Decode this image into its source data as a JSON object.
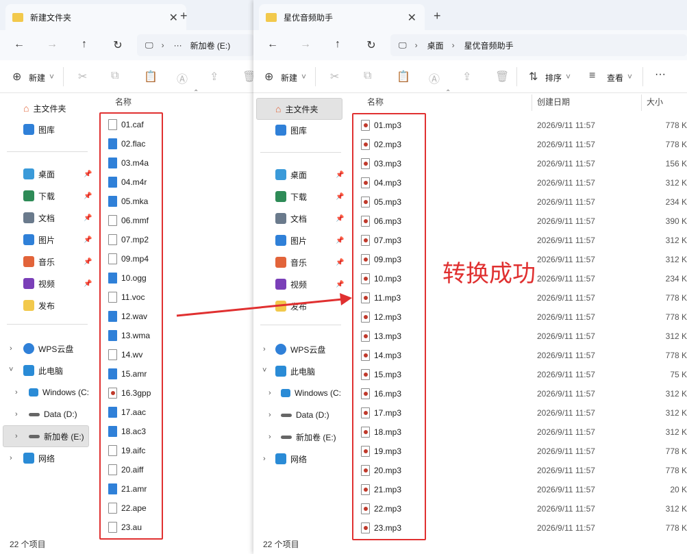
{
  "left": {
    "tab_title": "新建文件夹",
    "path": [
      "新加卷 (E:)"
    ],
    "path_more": "···",
    "toolbar_new": "新建",
    "col_name": "名称",
    "nav": {
      "home": "主文件夹",
      "gallery": "图库",
      "quick": [
        {
          "label": "桌面",
          "icon": "desktop-icon",
          "color": "#3a9ad9"
        },
        {
          "label": "下载",
          "icon": "download-icon",
          "color": "#2e8b57"
        },
        {
          "label": "文档",
          "icon": "document-icon",
          "color": "#6a7a8c"
        },
        {
          "label": "图片",
          "icon": "picture-icon",
          "color": "#2f80d8"
        },
        {
          "label": "音乐",
          "icon": "music-icon",
          "color": "#e2643a"
        },
        {
          "label": "视频",
          "icon": "video-icon",
          "color": "#7a3fb8"
        },
        {
          "label": "发布",
          "icon": "folder-icon",
          "color": "#f2c94c"
        }
      ],
      "wps": "WPS云盘",
      "thispc": "此电脑",
      "drives": [
        "Windows (C:",
        "Data (D:)",
        "新加卷 (E:)"
      ],
      "network": "网络"
    },
    "files": [
      {
        "name": "01.caf",
        "type": "plain"
      },
      {
        "name": "02.flac",
        "type": "media"
      },
      {
        "name": "03.m4a",
        "type": "media"
      },
      {
        "name": "04.m4r",
        "type": "media"
      },
      {
        "name": "05.mka",
        "type": "media"
      },
      {
        "name": "06.mmf",
        "type": "plain"
      },
      {
        "name": "07.mp2",
        "type": "plain"
      },
      {
        "name": "09.mp4",
        "type": "plain"
      },
      {
        "name": "10.ogg",
        "type": "media"
      },
      {
        "name": "11.voc",
        "type": "plain"
      },
      {
        "name": "12.wav",
        "type": "media"
      },
      {
        "name": "13.wma",
        "type": "media"
      },
      {
        "name": "14.wv",
        "type": "plain"
      },
      {
        "name": "15.amr",
        "type": "media"
      },
      {
        "name": "16.3gpp",
        "type": "mp3"
      },
      {
        "name": "17.aac",
        "type": "media"
      },
      {
        "name": "18.ac3",
        "type": "media"
      },
      {
        "name": "19.aifc",
        "type": "plain"
      },
      {
        "name": "20.aiff",
        "type": "plain"
      },
      {
        "name": "21.amr",
        "type": "media"
      },
      {
        "name": "22.ape",
        "type": "plain"
      },
      {
        "name": "23.au",
        "type": "plain"
      }
    ],
    "status": "22 个项目"
  },
  "right": {
    "tab_title": "星优音频助手",
    "path": [
      "桌面",
      "星优音频助手"
    ],
    "toolbar_new": "新建",
    "toolbar_sort": "排序",
    "toolbar_view": "查看",
    "toolbar_more": "···",
    "col_name": "名称",
    "col_date": "创建日期",
    "col_size": "大小",
    "nav": {
      "home": "主文件夹",
      "gallery": "图库",
      "quick": [
        {
          "label": "桌面",
          "icon": "desktop-icon",
          "color": "#3a9ad9"
        },
        {
          "label": "下载",
          "icon": "download-icon",
          "color": "#2e8b57"
        },
        {
          "label": "文档",
          "icon": "document-icon",
          "color": "#6a7a8c"
        },
        {
          "label": "图片",
          "icon": "picture-icon",
          "color": "#2f80d8"
        },
        {
          "label": "音乐",
          "icon": "music-icon",
          "color": "#e2643a"
        },
        {
          "label": "视频",
          "icon": "video-icon",
          "color": "#7a3fb8"
        },
        {
          "label": "发布",
          "icon": "folder-icon",
          "color": "#f2c94c"
        }
      ],
      "wps": "WPS云盘",
      "thispc": "此电脑",
      "drives": [
        "Windows (C:",
        "Data (D:)",
        "新加卷 (E:)"
      ],
      "network": "网络"
    },
    "files": [
      {
        "name": "01.mp3",
        "date": "2026/9/11 11:57",
        "size": "778 K"
      },
      {
        "name": "02.mp3",
        "date": "2026/9/11 11:57",
        "size": "778 K"
      },
      {
        "name": "03.mp3",
        "date": "2026/9/11 11:57",
        "size": "156 K"
      },
      {
        "name": "04.mp3",
        "date": "2026/9/11 11:57",
        "size": "312 K"
      },
      {
        "name": "05.mp3",
        "date": "2026/9/11 11:57",
        "size": "234 K"
      },
      {
        "name": "06.mp3",
        "date": "2026/9/11 11:57",
        "size": "390 K"
      },
      {
        "name": "07.mp3",
        "date": "2026/9/11 11:57",
        "size": "312 K"
      },
      {
        "name": "09.mp3",
        "date": "2026/9/11 11:57",
        "size": "312 K"
      },
      {
        "name": "10.mp3",
        "date": "2026/9/11 11:57",
        "size": "234 K"
      },
      {
        "name": "11.mp3",
        "date": "2026/9/11 11:57",
        "size": "778 K"
      },
      {
        "name": "12.mp3",
        "date": "2026/9/11 11:57",
        "size": "778 K"
      },
      {
        "name": "13.mp3",
        "date": "2026/9/11 11:57",
        "size": "312 K"
      },
      {
        "name": "14.mp3",
        "date": "2026/9/11 11:57",
        "size": "778 K"
      },
      {
        "name": "15.mp3",
        "date": "2026/9/11 11:57",
        "size": "75 K"
      },
      {
        "name": "16.mp3",
        "date": "2026/9/11 11:57",
        "size": "312 K"
      },
      {
        "name": "17.mp3",
        "date": "2026/9/11 11:57",
        "size": "312 K"
      },
      {
        "name": "18.mp3",
        "date": "2026/9/11 11:57",
        "size": "312 K"
      },
      {
        "name": "19.mp3",
        "date": "2026/9/11 11:57",
        "size": "778 K"
      },
      {
        "name": "20.mp3",
        "date": "2026/9/11 11:57",
        "size": "778 K"
      },
      {
        "name": "21.mp3",
        "date": "2026/9/11 11:57",
        "size": "20 K"
      },
      {
        "name": "22.mp3",
        "date": "2026/9/11 11:57",
        "size": "312 K"
      },
      {
        "name": "23.mp3",
        "date": "2026/9/11 11:57",
        "size": "778 K"
      }
    ],
    "status": "22 个项目"
  },
  "annotation": {
    "text": "转换成功",
    "color": "#e03030"
  }
}
